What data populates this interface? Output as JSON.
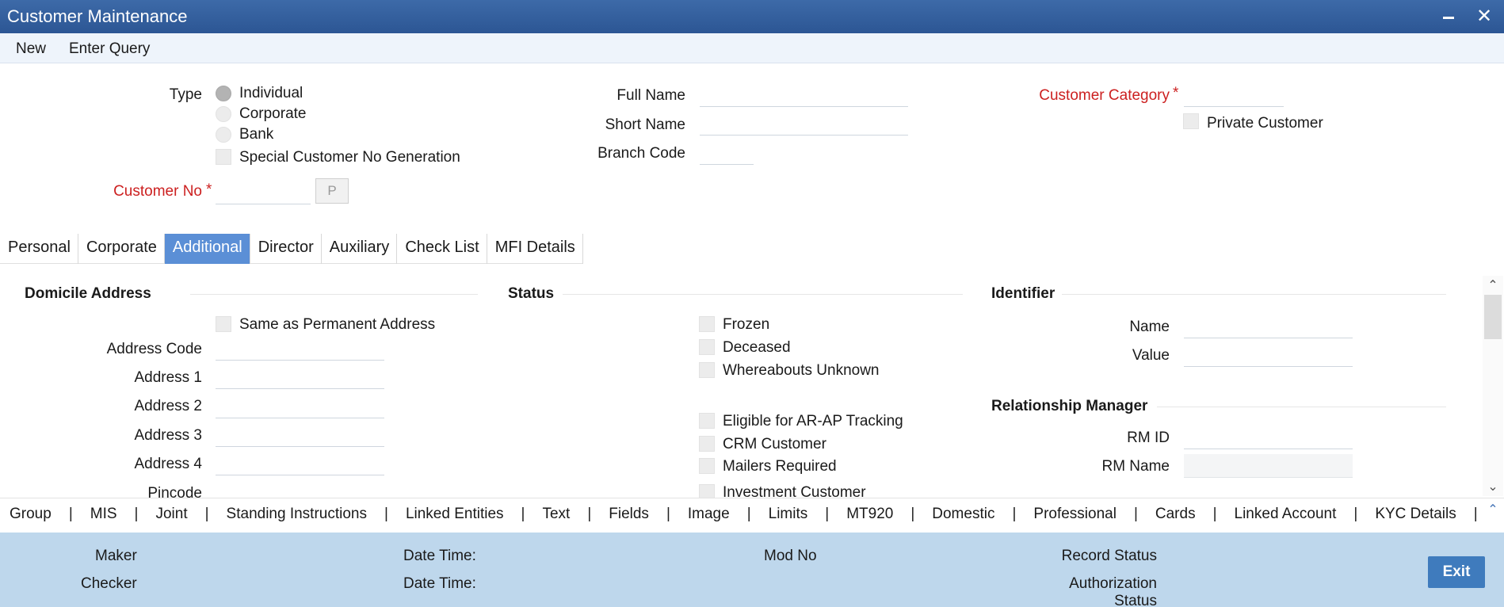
{
  "window": {
    "title": "Customer Maintenance"
  },
  "toolbar": {
    "new_label": "New",
    "enter_query_label": "Enter Query"
  },
  "header": {
    "type_label": "Type",
    "type_options": [
      "Individual",
      "Corporate",
      "Bank"
    ],
    "type_selected": "Individual",
    "special_customer_no_label": "Special Customer No Generation",
    "customer_no_label": "Customer No",
    "customer_no_value": "",
    "p_button_label": "P",
    "full_name_label": "Full Name",
    "full_name_value": "",
    "short_name_label": "Short Name",
    "short_name_value": "",
    "branch_code_label": "Branch Code",
    "branch_code_value": "",
    "customer_category_label": "Customer Category",
    "customer_category_value": "",
    "private_customer_label": "Private Customer",
    "required_mark": "*"
  },
  "tabs": [
    "Personal",
    "Corporate",
    "Additional",
    "Director",
    "Auxiliary",
    "Check List",
    "MFI Details"
  ],
  "active_tab": "Additional",
  "domicile": {
    "title": "Domicile Address",
    "same_as_permanent_label": "Same as Permanent Address",
    "fields": [
      "Address Code",
      "Address 1",
      "Address 2",
      "Address 3",
      "Address 4",
      "Pincode"
    ]
  },
  "status": {
    "title": "Status",
    "checks_top": [
      "Frozen",
      "Deceased",
      "Whereabouts Unknown"
    ],
    "checks_bottom": [
      "Eligible for AR-AP Tracking",
      "CRM Customer",
      "Mailers Required",
      "Investment Customer"
    ]
  },
  "identifier": {
    "title": "Identifier",
    "name_label": "Name",
    "value_label": "Value",
    "rm_title": "Relationship Manager",
    "rm_id_label": "RM ID",
    "rm_name_label": "RM Name"
  },
  "sublinks": [
    "Group",
    "MIS",
    "Joint",
    "Standing Instructions",
    "Linked Entities",
    "Text",
    "Fields",
    "Image",
    "Limits",
    "MT920",
    "Domestic",
    "Professional",
    "Cards",
    "Linked Account",
    "KYC Details"
  ],
  "sublinks_separator": "|",
  "footer": {
    "maker_label": "Maker",
    "checker_label": "Checker",
    "date_time_label": "Date Time:",
    "mod_no_label": "Mod No",
    "record_status_label": "Record Status",
    "authorization_status_label": "Authorization Status",
    "exit_label": "Exit"
  }
}
